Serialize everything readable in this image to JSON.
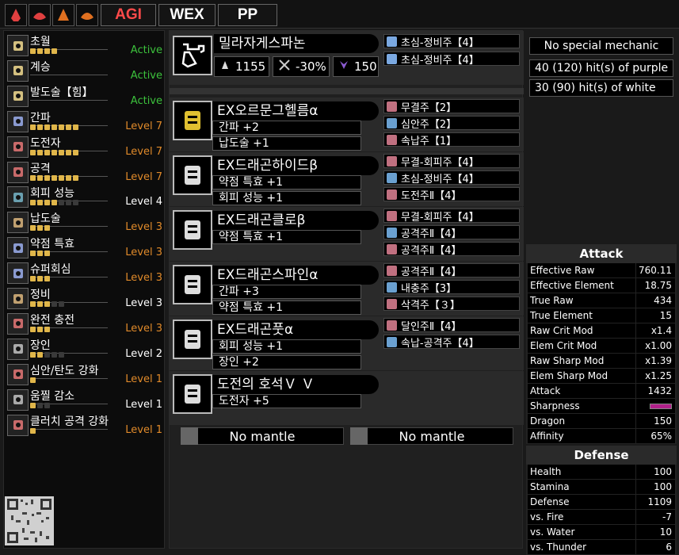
{
  "topbar": {
    "buttons": [
      "AGI",
      "WEX",
      "PP"
    ],
    "icons": [
      "monster-icon-1",
      "monster-icon-2",
      "monster-icon-3",
      "monster-icon-4"
    ]
  },
  "skills": [
    {
      "name": "초월",
      "filled": 4,
      "total": 4,
      "level": "Active",
      "color": "#3cc23c",
      "icon": "#d4c080"
    },
    {
      "name": "계승",
      "filled": 0,
      "total": 0,
      "level": "Active",
      "color": "#3cc23c",
      "icon": "#d4c080"
    },
    {
      "name": "발도술【힘】",
      "filled": 0,
      "total": 0,
      "level": "Active",
      "color": "#3cc23c",
      "icon": "#d4c080"
    },
    {
      "name": "간파",
      "filled": 7,
      "total": 7,
      "level": "Level 7",
      "color": "#e08a2a",
      "icon": "#8a9ad0"
    },
    {
      "name": "도전자",
      "filled": 7,
      "total": 7,
      "level": "Level 7",
      "color": "#e08a2a",
      "icon": "#c86a6a"
    },
    {
      "name": "공격",
      "filled": 7,
      "total": 7,
      "level": "Level 7",
      "color": "#e08a2a",
      "icon": "#c86a6a"
    },
    {
      "name": "회피 성능",
      "filled": 4,
      "total": 7,
      "level": "Level 4",
      "color": "#ffffff",
      "icon": "#6aa0b0"
    },
    {
      "name": "납도술",
      "filled": 3,
      "total": 3,
      "level": "Level 3",
      "color": "#e08a2a",
      "icon": "#c0a070"
    },
    {
      "name": "약점 특효",
      "filled": 3,
      "total": 3,
      "level": "Level 3",
      "color": "#e08a2a",
      "icon": "#8a9ad0"
    },
    {
      "name": "슈퍼회심",
      "filled": 3,
      "total": 3,
      "level": "Level 3",
      "color": "#e08a2a",
      "icon": "#8a9ad0"
    },
    {
      "name": "정비",
      "filled": 3,
      "total": 5,
      "level": "Level 3",
      "color": "#ffffff",
      "icon": "#c0a070"
    },
    {
      "name": "완전 충전",
      "filled": 3,
      "total": 3,
      "level": "Level 3",
      "color": "#e08a2a",
      "icon": "#c86a6a"
    },
    {
      "name": "장인",
      "filled": 2,
      "total": 5,
      "level": "Level 2",
      "color": "#ffffff",
      "icon": "#aaaaaa"
    },
    {
      "name": "심안/탄도 강화",
      "filled": 1,
      "total": 1,
      "level": "Level 1",
      "color": "#e08a2a",
      "icon": "#c86a6a"
    },
    {
      "name": "움찔 감소",
      "filled": 1,
      "total": 3,
      "level": "Level 1",
      "color": "#ffffff",
      "icon": "#aaaaaa"
    },
    {
      "name": "클러치 공격 강화",
      "filled": 1,
      "total": 1,
      "level": "Level 1",
      "color": "#e08a2a",
      "icon": "#c86a6a"
    }
  ],
  "weapon": {
    "name": "밀라자게스파논",
    "attack": "1155",
    "affinity": "-30%",
    "element": "150",
    "decos": [
      "초심-정비주【4】",
      "초심-정비주【4】"
    ]
  },
  "armor": [
    {
      "name": "EXOrmoonHelmα",
      "label": "EX오르문그헬름α",
      "skills": [
        "간파 +2",
        "납도술 +1"
      ],
      "decos": [
        "무결주【2】",
        "심안주【2】",
        "속납주【1】"
      ]
    },
    {
      "name": "EXDragonHide",
      "label": "EX드래곤하이드β",
      "skills": [
        "약점 특효 +1",
        "회피 성능 +1"
      ],
      "decos": [
        "무결-회피주【4】",
        "초심-정비주【4】",
        "도전주Ⅱ【4】"
      ]
    },
    {
      "name": "EXDragonClaw",
      "label": "EX드래곤클로β",
      "skills": [
        "약점 특효 +1"
      ],
      "decos": [
        "무결-회피주【4】",
        "공격주Ⅱ【4】",
        "공격주Ⅱ【4】"
      ]
    },
    {
      "name": "EXDragonSpine",
      "label": "EX드래곤스파인α",
      "skills": [
        "간파 +3",
        "약점 특효 +1"
      ],
      "decos": [
        "공격주Ⅱ【4】",
        "내충주【3】",
        "삭격주【３】"
      ]
    },
    {
      "name": "EXDragonFoot",
      "label": "EX드래곤풋α",
      "skills": [
        "회피 성능 +1",
        "장인 +2"
      ],
      "decos": [
        "달인주Ⅱ【4】",
        "속납-공격주【4】"
      ]
    },
    {
      "name": "Charm",
      "label": "도전의 호석Ｖ Ｖ",
      "skills": [
        "도전자 +5"
      ],
      "decos": []
    }
  ],
  "mantles": [
    "No mantle",
    "No mantle"
  ],
  "info": [
    "No special mechanic",
    "40 (120) hit(s) of purple",
    "30 (90) hit(s) of white"
  ],
  "attack": {
    "title": "Attack",
    "rows": [
      [
        "Effective Raw",
        "760.11"
      ],
      [
        "Effective Element",
        "18.75"
      ],
      [
        "True Raw",
        "434"
      ],
      [
        "True Element",
        "15"
      ],
      [
        "Raw Crit Mod",
        "x1.4"
      ],
      [
        "Elem Crit Mod",
        "x1.00"
      ],
      [
        "Raw Sharp Mod",
        "x1.39"
      ],
      [
        "Elem Sharp Mod",
        "x1.25"
      ],
      [
        "Attack",
        "1432"
      ],
      [
        "Sharpness",
        ""
      ],
      [
        "Dragon",
        "150"
      ],
      [
        "Affinity",
        "65%"
      ]
    ]
  },
  "defense": {
    "title": "Defense",
    "rows": [
      [
        "Health",
        "100"
      ],
      [
        "Stamina",
        "100"
      ],
      [
        "Defense",
        "1109"
      ],
      [
        "vs. Fire",
        "-7"
      ],
      [
        "vs. Water",
        "10"
      ],
      [
        "vs. Thunder",
        "6"
      ]
    ]
  },
  "colors": {
    "active": "#3cc23c",
    "maxed": "#e08a2a",
    "normal": "#ffffff",
    "pip": "#e0b64a",
    "sharpness": "#b0208a"
  }
}
